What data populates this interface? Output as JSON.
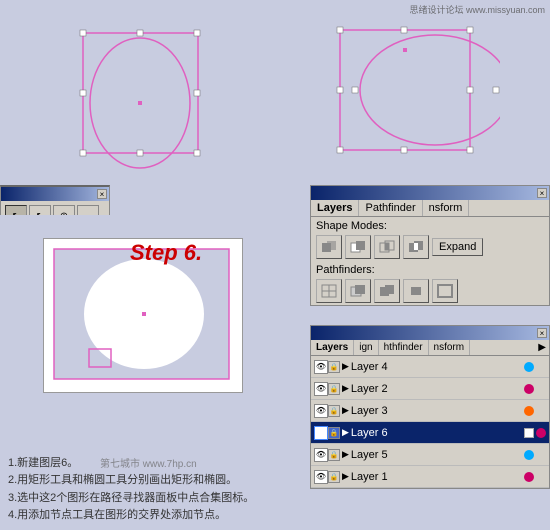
{
  "watermark_top": "思绪设计论坛 www.missyuan.com",
  "watermark_bottom": "第七城市  www.7hp.cn",
  "step_label": "Step 6.",
  "instructions": {
    "line1": "1.新建图层6。",
    "line2": "2.用矩形工具和椭圆工具分别画出矩形和椭圆。",
    "line3": "3.选中这2个图形在路径寻找器面板中点合集图标。",
    "line4": "4.用添加节点工具在图形的交界处添加节点。"
  },
  "pathfinder_panel": {
    "tabs": [
      "Layers",
      "Pathfinder",
      "nsform"
    ],
    "active_tab": "Pathfinder",
    "shape_modes_label": "Shape Modes:",
    "expand_label": "Expand",
    "pathfinders_label": "Pathfinders:"
  },
  "layers_panel": {
    "tabs": [
      "Layers",
      "ign",
      "hthfinder",
      "nsform"
    ],
    "active_tab": "Layers",
    "layers": [
      {
        "name": "Layer 4",
        "visible": true,
        "locked": false,
        "selected": false,
        "color": "#00aaff"
      },
      {
        "name": "Layer 2",
        "visible": true,
        "locked": false,
        "selected": false,
        "color": "#cc0066"
      },
      {
        "name": "Layer 3",
        "visible": true,
        "locked": false,
        "selected": false,
        "color": "#ff6600"
      },
      {
        "name": "Layer 6",
        "visible": true,
        "locked": false,
        "selected": true,
        "color": "#cc0066",
        "has_square": true
      },
      {
        "name": "Layer 5",
        "visible": true,
        "locked": false,
        "selected": false,
        "color": "#00aaff"
      },
      {
        "name": "Layer 1",
        "visible": true,
        "locked": false,
        "selected": false,
        "color": "#cc0066"
      }
    ]
  },
  "toolbar": {
    "tools": [
      "↖",
      "↖",
      "⊕"
    ]
  }
}
